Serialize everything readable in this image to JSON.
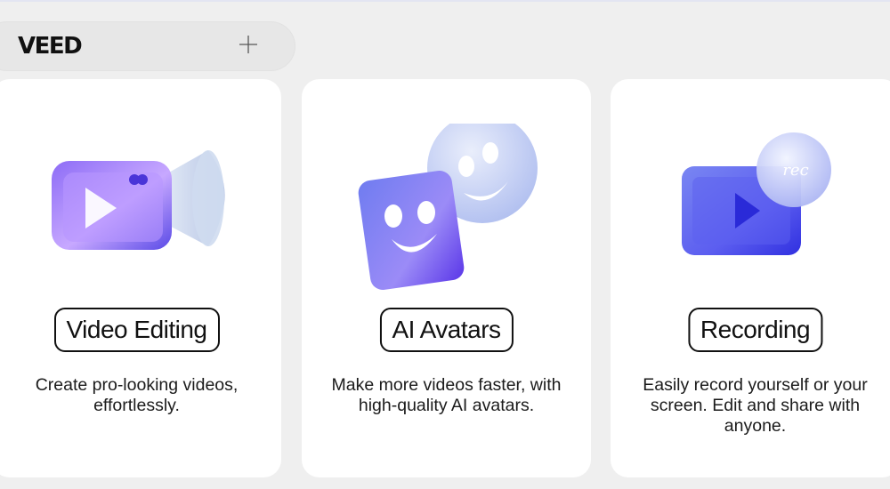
{
  "header": {
    "logo_text": "VEED",
    "add_icon": "plus-icon"
  },
  "cards": [
    {
      "title": "Video Editing",
      "description": "Create pro-looking videos, effortlessly.",
      "illustration": "video-camera-icon"
    },
    {
      "title": "AI Avatars",
      "description": "Make more videos faster, with high-quality AI avatars.",
      "illustration": "smiley-faces-icon"
    },
    {
      "title": "Recording",
      "description": "Easily record yourself or your screen. Edit and share with anyone.",
      "illustration": "rec-screen-icon",
      "badge_text": "rec"
    }
  ],
  "colors": {
    "background": "#efefef",
    "card": "#ffffff",
    "accent_purple": "#7b5cf0",
    "accent_blue": "#3a3ff0"
  }
}
